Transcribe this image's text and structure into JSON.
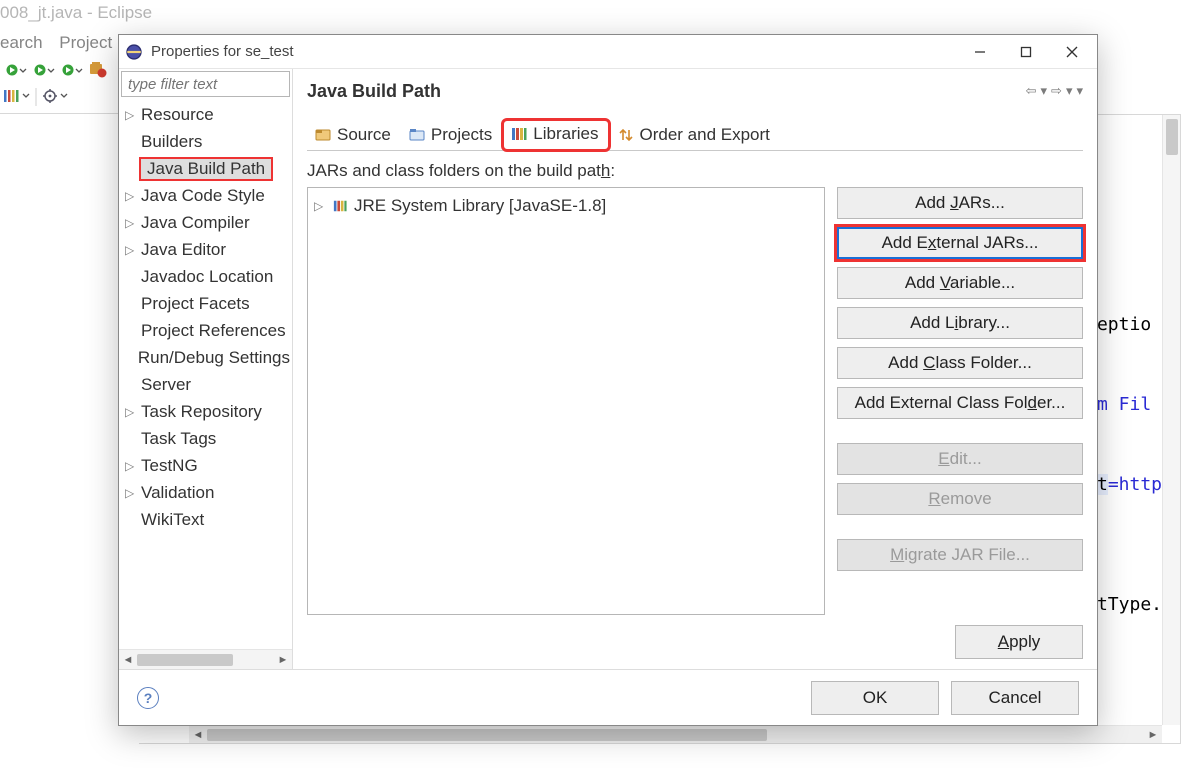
{
  "eclipse": {
    "window_title_fragment": "008_jt.java - Eclipse",
    "menu_fragments": [
      "earch",
      "Project"
    ]
  },
  "code_fragments": {
    "l1": "eptio",
    "l2": "m Fil",
    "l3_key": "t",
    "l3_val_prefix": "=http",
    "l4": "tType."
  },
  "dialog": {
    "title": "Properties for se_test",
    "filter_placeholder": "type filter text",
    "sidebar_items": [
      {
        "label": "Resource",
        "expandable": true
      },
      {
        "label": "Builders",
        "expandable": false
      },
      {
        "label": "Java Build Path",
        "expandable": false,
        "selected": true
      },
      {
        "label": "Java Code Style",
        "expandable": true
      },
      {
        "label": "Java Compiler",
        "expandable": true
      },
      {
        "label": "Java Editor",
        "expandable": true
      },
      {
        "label": "Javadoc Location",
        "expandable": false
      },
      {
        "label": "Project Facets",
        "expandable": false
      },
      {
        "label": "Project References",
        "expandable": false
      },
      {
        "label": "Run/Debug Settings",
        "expandable": false
      },
      {
        "label": "Server",
        "expandable": false
      },
      {
        "label": "Task Repository",
        "expandable": true
      },
      {
        "label": "Task Tags",
        "expandable": false
      },
      {
        "label": "TestNG",
        "expandable": true
      },
      {
        "label": "Validation",
        "expandable": true
      },
      {
        "label": "WikiText",
        "expandable": false
      }
    ],
    "main_title": "Java Build Path",
    "tabs": {
      "source": "Source",
      "projects": "Projects",
      "libraries": "Libraries",
      "order_export": "Order and Export"
    },
    "libraries_desc_pre": "JARs and class folders on the build pat",
    "libraries_desc_u": "h",
    "libraries_desc_post": ":",
    "lib_entries": [
      "JRE System Library [JavaSE-1.8]"
    ],
    "buttons": {
      "add_jars_pre": "Add ",
      "add_jars_u": "J",
      "add_jars_post": "ARs...",
      "add_ext_jars_pre": "Add E",
      "add_ext_jars_u": "x",
      "add_ext_jars_post": "ternal JARs...",
      "add_var_pre": "Add ",
      "add_var_u": "V",
      "add_var_post": "ariable...",
      "add_lib_pre": "Add L",
      "add_lib_u": "i",
      "add_lib_post": "brary...",
      "add_cf_pre": "Add ",
      "add_cf_u": "C",
      "add_cf_post": "lass Folder...",
      "add_ecf_pre": "Add External Class Fol",
      "add_ecf_u": "d",
      "add_ecf_post": "er...",
      "edit_u": "E",
      "edit_post": "dit...",
      "remove_u": "R",
      "remove_post": "emove",
      "migrate_u": "M",
      "migrate_post": "igrate JAR File...",
      "apply_u": "A",
      "apply_post": "pply",
      "ok": "OK",
      "cancel": "Cancel"
    }
  }
}
